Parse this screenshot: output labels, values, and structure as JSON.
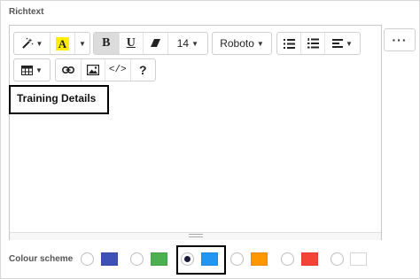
{
  "field": {
    "label": "Richtext"
  },
  "toolbar": {
    "font_size": "14",
    "font_family": "Roboto",
    "bold_label": "B",
    "underline_label": "U",
    "text_color_label": "A",
    "code_label": "</>",
    "help_label": "?"
  },
  "more_button": {
    "label": "···"
  },
  "content": {
    "text": "Training Details"
  },
  "colour_scheme": {
    "label": "Colour scheme",
    "selected_index": 2,
    "options": [
      {
        "color": "#3f51b5"
      },
      {
        "color": "#4caf50"
      },
      {
        "color": "#2196f3"
      },
      {
        "color": "#ff9800"
      },
      {
        "color": "#f44336"
      },
      {
        "color": "#ffffff"
      }
    ]
  },
  "colors": {
    "highlight": "#ffee00",
    "active_button_bg": "#dcdcdc"
  }
}
